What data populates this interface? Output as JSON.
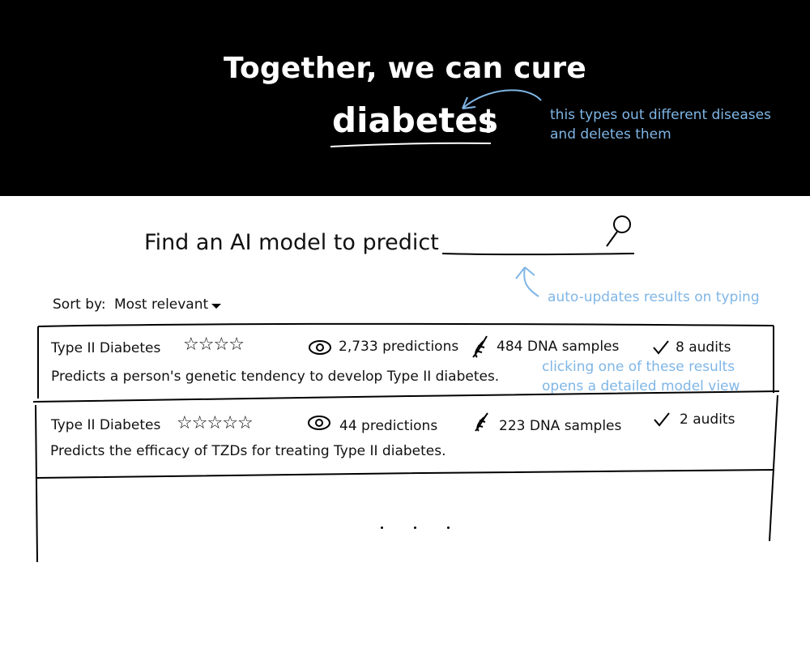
{
  "hero": {
    "headline": "Together, we can cure",
    "rotating_word": "diabetes",
    "cursor_glyph": "I"
  },
  "annotations": {
    "hero_note": "this types out different diseases and deletes them",
    "search_note": "auto-updates results on typing",
    "results_note": "clicking one of these results opens a detailed model view"
  },
  "search": {
    "label": "Find an AI model to predict",
    "value": "",
    "icon": "magnifier-icon"
  },
  "sort": {
    "label": "Sort by:",
    "selected": "Most relevant",
    "icon": "caret-down-icon"
  },
  "results": [
    {
      "name": "Type II Diabetes",
      "rating": 4,
      "predictions": "2,733 predictions",
      "samples": "484 DNA samples",
      "audits": "8 audits",
      "description": "Predicts a person's genetic tendency to develop Type II diabetes."
    },
    {
      "name": "Type II Diabetes",
      "rating": 5,
      "predictions": "44 predictions",
      "samples": "223 DNA samples",
      "audits": "2 audits",
      "description": "Predicts the efficacy of TZDs for treating Type II diabetes."
    }
  ],
  "icons": {
    "stars": "star-icon",
    "predictions": "eye-icon",
    "samples": "dna-icon",
    "audits": "checkmark-icon"
  },
  "colors": {
    "hero_background": "#000000",
    "annotation": "#7fb6e6"
  }
}
